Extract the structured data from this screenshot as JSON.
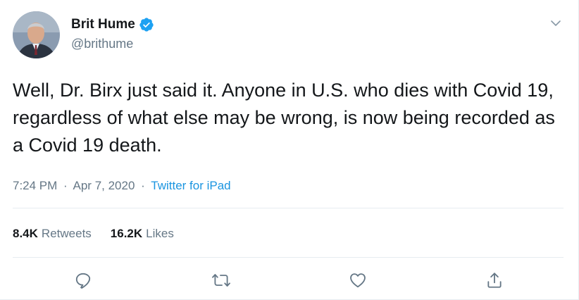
{
  "tweet": {
    "author": {
      "display_name": "Brit Hume",
      "handle": "@brithume",
      "verified": true
    },
    "text": "Well, Dr. Birx just said it. Anyone in U.S. who dies with Covid 19, regardless of what else may be wrong, is now being recorded as a Covid 19 death.",
    "time": "7:24 PM",
    "separator": "·",
    "date": "Apr 7, 2020",
    "source": "Twitter for iPad",
    "stats": {
      "retweets_count": "8.4K",
      "retweets_label": "Retweets",
      "likes_count": "16.2K",
      "likes_label": "Likes"
    },
    "actions": [
      {
        "icon": "reply-icon"
      },
      {
        "icon": "retweet-icon"
      },
      {
        "icon": "like-icon"
      },
      {
        "icon": "share-icon"
      }
    ]
  },
  "colors": {
    "text": "#14171a",
    "secondary": "#657786",
    "link": "#1b95e0",
    "verified": "#1da1f2",
    "divider": "#e6ecf0"
  }
}
